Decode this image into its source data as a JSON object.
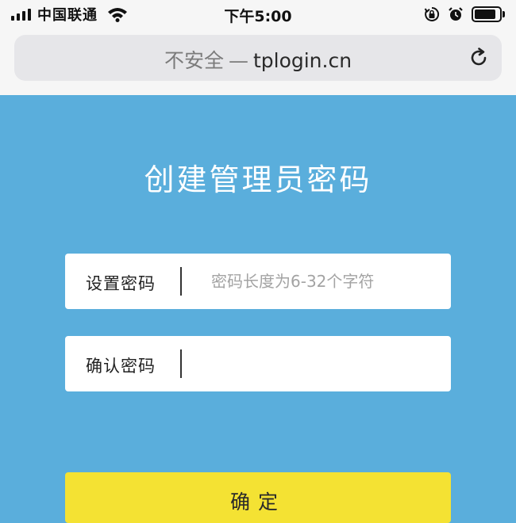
{
  "status_bar": {
    "carrier": "中国联通",
    "time": "下午5:00",
    "icons": [
      "signal-icon",
      "wifi-icon",
      "orientation-lock-icon",
      "alarm-icon",
      "battery-icon"
    ]
  },
  "browser": {
    "security_label": "不安全",
    "separator": "—",
    "domain": "tplogin.cn",
    "reload_icon": "reload-icon"
  },
  "form": {
    "title": "创建管理员密码",
    "password": {
      "label": "设置密码",
      "placeholder": "密码长度为6-32个字符",
      "value": ""
    },
    "confirm_password": {
      "label": "确认密码",
      "placeholder": "",
      "value": ""
    },
    "submit_label": "确定"
  },
  "colors": {
    "page_background": "#5aaedc",
    "browser_chrome": "#f6f6f6",
    "button": "#f4e233"
  }
}
